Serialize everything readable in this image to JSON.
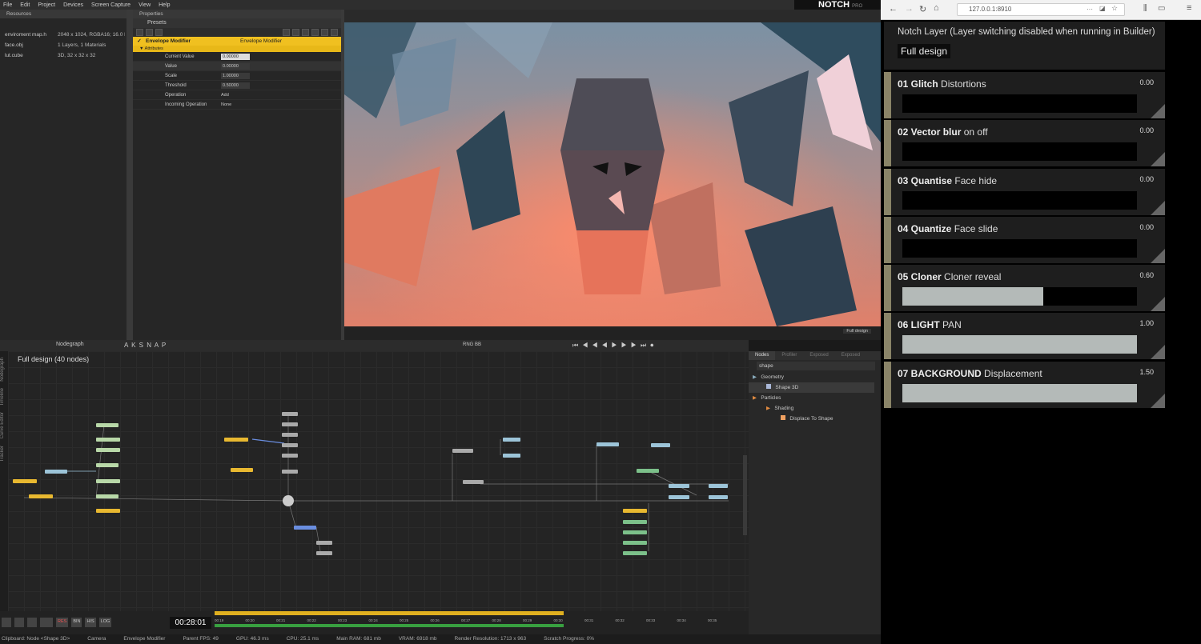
{
  "menu": [
    "File",
    "Edit",
    "Project",
    "Devices",
    "Screen Capture",
    "View",
    "Help"
  ],
  "logo": {
    "text": "NOTCH",
    "sub": "PRO"
  },
  "resources": {
    "title": "Resources",
    "items": [
      {
        "name": "enviroment map.h",
        "desc": "2048 x 1024, RGBA16; 16.0 M"
      },
      {
        "name": "face.obj",
        "desc": "1 Layers, 1 Materials"
      },
      {
        "name": "lut.cube",
        "desc": "3D, 32 x 32 x 32"
      }
    ]
  },
  "properties": {
    "title": "Properties",
    "presets": "Presets",
    "node_name": "Envelope Modifier",
    "node_type": "Envelope Modifier",
    "section": "Attributes",
    "rows": [
      {
        "label": "Current Value",
        "value": "0.00000"
      },
      {
        "label": "Value",
        "value": "0.00000"
      },
      {
        "label": "Scale",
        "value": "1.00000"
      },
      {
        "label": "Threshold",
        "value": "0.50000"
      },
      {
        "label": "Operation",
        "value": "Add"
      },
      {
        "label": "Incoming Operation",
        "value": "None"
      }
    ]
  },
  "viewport": {
    "layer_label": "Full design"
  },
  "nodegraph": {
    "tab": "Nodegraph",
    "snap": "A K S N A P",
    "title": "Full design",
    "count": "(40 nodes)",
    "side_tabs": [
      "Nodegraph",
      "Timeline",
      "Curve Editor",
      "Tracker"
    ],
    "transport_labels": [
      "RNG",
      "BB"
    ]
  },
  "nodes_panel": {
    "tabs": [
      "Nodes",
      "Profiler",
      "Exposed",
      "Exposed"
    ],
    "search": "shape",
    "tree": [
      {
        "label": "Geometry",
        "level": 0
      },
      {
        "label": "Shape 3D",
        "level": 1
      },
      {
        "label": "Particles",
        "level": 0
      },
      {
        "label": "Shading",
        "level": 1
      },
      {
        "label": "Displace To Shape",
        "level": 2
      }
    ]
  },
  "timeline": {
    "time": "00:28:01",
    "buttons": [
      "RES",
      "BIN",
      "HIS",
      "LOG"
    ],
    "ticks": [
      "00:19",
      "00:20",
      "00:21",
      "00:22",
      "00:23",
      "00:24",
      "00:25",
      "00:26",
      "00:27",
      "00:28",
      "00:29",
      "00:30",
      "00:31",
      "00:32",
      "00:33",
      "00:34",
      "00:35"
    ]
  },
  "status": {
    "items": [
      "Clipboard: Node <Shape 3D>",
      "Camera",
      "Envelope Modifier",
      "Parent FPS: 49",
      "GPU: 46.3 ms",
      "CPU: 25.1 ms",
      "Main RAM: 681 mb",
      "VRAM: 6918 mb",
      "Render Resolution: 1713 x 963",
      "Scratch Progress: 0%"
    ]
  },
  "browser": {
    "url": "127.0.0.1:8910",
    "header": "Notch Layer (Layer switching disabled when running in Builder)",
    "layer": "Full design",
    "colors": {
      "accent": "#8a8468",
      "fill": "#b4bab8"
    },
    "params": [
      {
        "bold": "01 Glitch",
        "rest": "Distortions",
        "value": "0.00",
        "level": 0.0
      },
      {
        "bold": "02 Vector blur",
        "rest": "on off",
        "value": "0.00",
        "level": 0.0
      },
      {
        "bold": "03 Quantise",
        "rest": "Face hide",
        "value": "0.00",
        "level": 0.0
      },
      {
        "bold": "04 Quantize",
        "rest": "Face slide",
        "value": "0.00",
        "level": 0.0
      },
      {
        "bold": "05 Cloner",
        "rest": "Cloner reveal",
        "value": "0.60",
        "level": 0.6
      },
      {
        "bold": "06 LIGHT",
        "rest": "PAN",
        "value": "1.00",
        "level": 1.0
      },
      {
        "bold": "07 BACKGROUND",
        "rest": "Displacement",
        "value": "1.50",
        "level": 1.0
      }
    ]
  }
}
